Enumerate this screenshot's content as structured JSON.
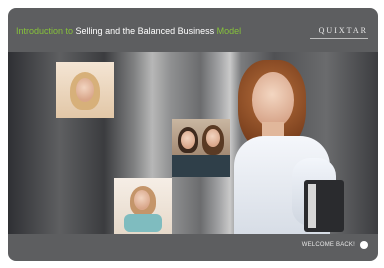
{
  "header": {
    "title_parts": [
      {
        "text": "Introduction to",
        "accent": true
      },
      {
        "text": " Selling and the Balanced Business ",
        "accent": false
      },
      {
        "text": "Model",
        "accent": true
      }
    ],
    "brand": "QUIXTAR"
  },
  "footer": {
    "welcome_back_label": "WELCOME BACK!"
  },
  "colors": {
    "accent": "#86c23a",
    "panel": "#5d5e60"
  },
  "icons": {
    "welcome_back": "circle-icon"
  }
}
